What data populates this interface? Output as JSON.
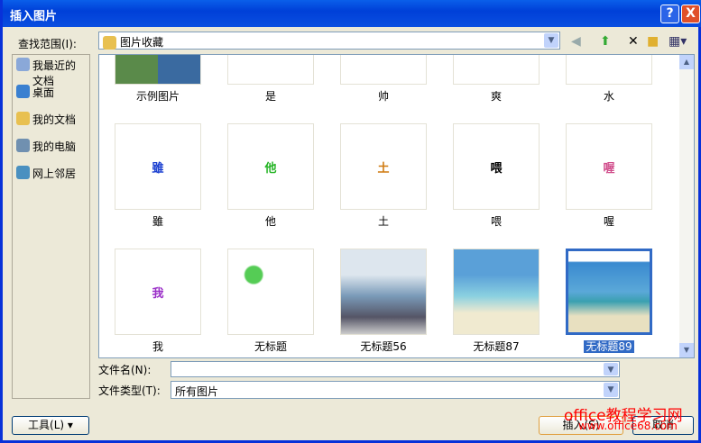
{
  "title": "插入图片",
  "title_buttons": {
    "help": "?",
    "close": "X"
  },
  "look_in": {
    "label": "查找范围(I):",
    "value": "图片收藏"
  },
  "toolbar": [
    "back-icon",
    "up-folder-icon",
    "delete-icon",
    "new-folder-icon",
    "views-icon"
  ],
  "places": [
    {
      "label": "我最近的文档"
    },
    {
      "label": "桌面"
    },
    {
      "label": "我的文档"
    },
    {
      "label": "我的电脑"
    },
    {
      "label": "网上邻居"
    }
  ],
  "files": [
    {
      "name": "示例图片",
      "glyph": ""
    },
    {
      "name": "是",
      "glyph": ""
    },
    {
      "name": "帅",
      "glyph": ""
    },
    {
      "name": "爽",
      "glyph": ""
    },
    {
      "name": "水",
      "glyph": ""
    },
    {
      "name": "雖",
      "glyph": "雖",
      "color": "#1a3fd0"
    },
    {
      "name": "他",
      "glyph": "他",
      "color": "#22b322"
    },
    {
      "name": "土",
      "glyph": "土",
      "color": "#d07a10"
    },
    {
      "name": "喂",
      "glyph": "喂",
      "color": "#000000"
    },
    {
      "name": "喔",
      "glyph": "喔",
      "color": "#d04b8a"
    },
    {
      "name": "我",
      "glyph": "我",
      "color": "#9b30c8"
    },
    {
      "name": "无标题",
      "glyph": ""
    },
    {
      "name": "无标题56",
      "glyph": ""
    },
    {
      "name": "无标题87",
      "glyph": ""
    },
    {
      "name": "无标题89",
      "glyph": "",
      "selected": true
    }
  ],
  "file_name": {
    "label": "文件名(N):",
    "value": ""
  },
  "file_type": {
    "label": "文件类型(T):",
    "value": "所有图片"
  },
  "buttons": {
    "tools": "工具(L)",
    "insert": "插入(S)",
    "cancel": "取消"
  },
  "watermark": {
    "line1": "office教程学习网",
    "line2": "www.office68.com"
  }
}
